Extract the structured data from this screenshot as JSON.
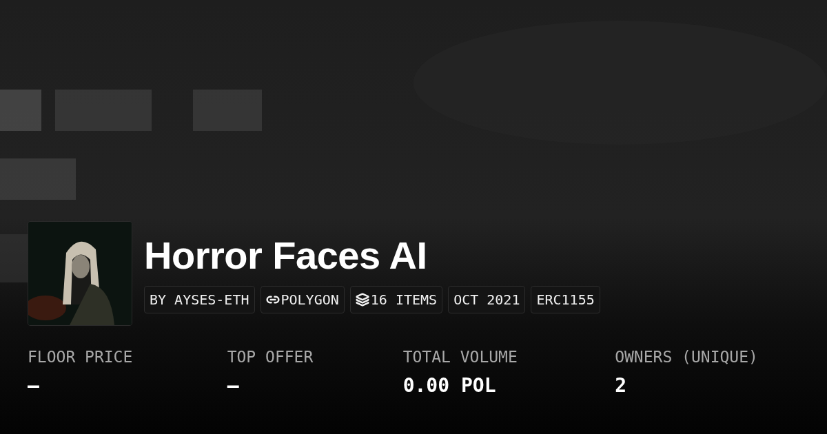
{
  "title": "Horror Faces AI",
  "tags": [
    {
      "kind": "text",
      "label": "BY AYSES-ETH"
    },
    {
      "kind": "chain",
      "label": "POLYGON"
    },
    {
      "kind": "layers",
      "label": "16 ITEMS"
    },
    {
      "kind": "text",
      "label": "OCT 2021"
    },
    {
      "kind": "text",
      "label": "ERC1155"
    }
  ],
  "stats": [
    {
      "label": "FLOOR PRICE",
      "value": "–"
    },
    {
      "label": "TOP OFFER",
      "value": "–"
    },
    {
      "label": "TOTAL VOLUME",
      "value": "0.00 POL"
    },
    {
      "label": "OWNERS (UNIQUE)",
      "value": "2"
    }
  ]
}
